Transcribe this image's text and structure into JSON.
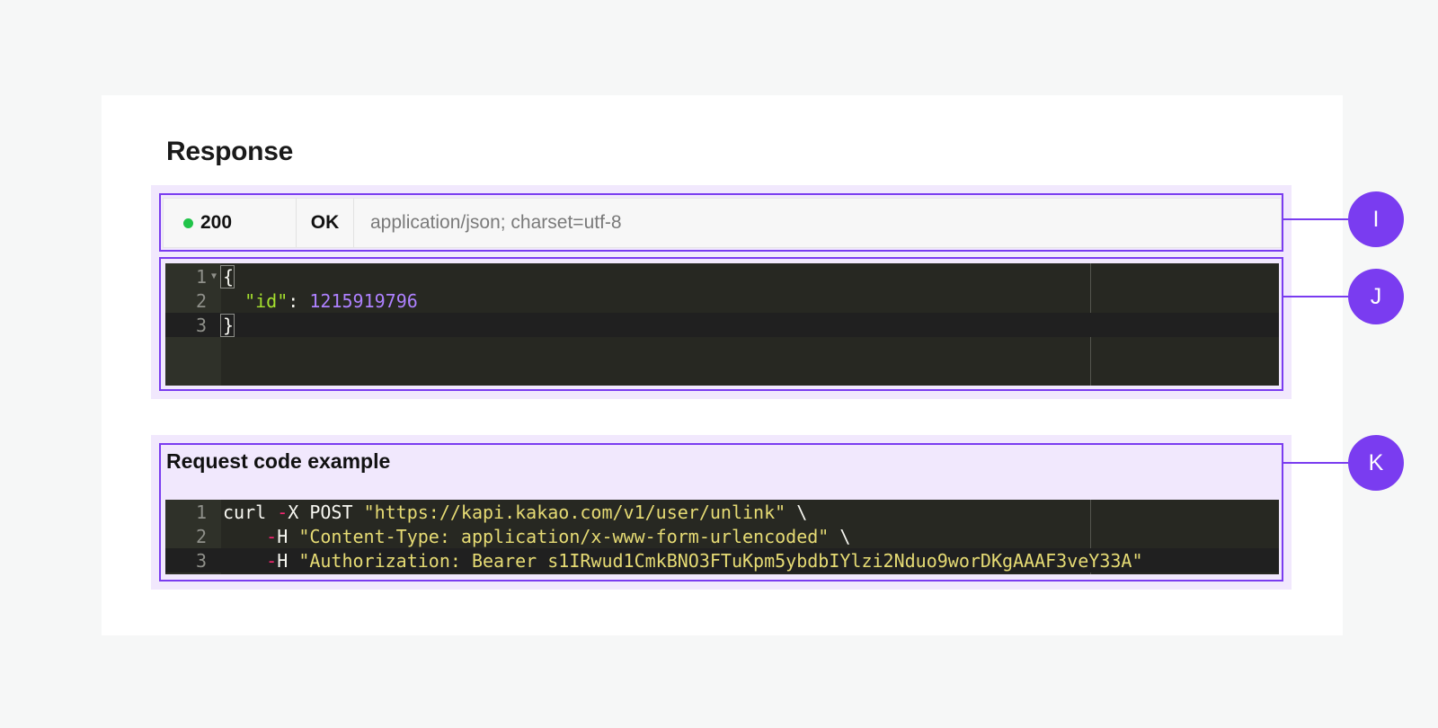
{
  "response": {
    "title": "Response",
    "status": {
      "code": "200",
      "text": "OK",
      "content_type": "application/json; charset=utf-8",
      "dot_color": "#21c449"
    },
    "body": {
      "line_numbers": [
        "1",
        "2",
        "3"
      ],
      "open_brace": "{",
      "key": "\"id\"",
      "colon": ": ",
      "value": "1215919796",
      "close_brace": "}"
    }
  },
  "request": {
    "title": "Request code example",
    "line_numbers": [
      "1",
      "2",
      "3"
    ],
    "line1": {
      "cmd": "curl ",
      "flag_dash": "-",
      "flag": "X POST ",
      "url": "\"https://kapi.kakao.com/v1/user/unlink\"",
      "cont": " \\"
    },
    "line2": {
      "indent": "    ",
      "flag_dash": "-",
      "flag": "H ",
      "header": "\"Content-Type: application/x-www-form-urlencoded\"",
      "cont": " \\"
    },
    "line3": {
      "indent": "    ",
      "flag_dash": "-",
      "flag": "H ",
      "header": "\"Authorization: Bearer s1IRwud1CmkBNO3FTuKpm5ybdbIYlzi2Nduo9worDKgAAAF3veY33A\""
    }
  },
  "callouts": {
    "i": "I",
    "j": "J",
    "k": "K"
  },
  "colors": {
    "accent": "#7a3cf0",
    "highlight": "#f1e8fd",
    "editor_bg": "#272822"
  }
}
